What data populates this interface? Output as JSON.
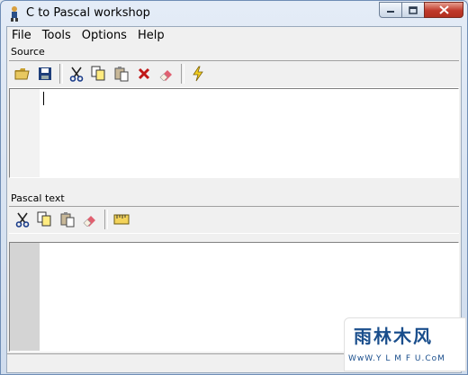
{
  "window": {
    "title": "C to Pascal workshop",
    "icon": "app-icon",
    "controls": [
      "minimize-icon",
      "maximize-icon",
      "close-icon"
    ]
  },
  "menubar": {
    "items": [
      {
        "label": "File"
      },
      {
        "label": "Tools"
      },
      {
        "label": "Options"
      },
      {
        "label": "Help"
      }
    ]
  },
  "source": {
    "label": "Source",
    "toolbar": [
      "open-folder-icon",
      "save-icon",
      "cut-icon",
      "copy-icon",
      "paste-icon",
      "delete-icon",
      "eraser-icon",
      "convert-lightning-icon"
    ],
    "editor_text": ""
  },
  "pascal": {
    "label": "Pascal text",
    "toolbar": [
      "cut-icon",
      "copy-icon",
      "paste-icon",
      "eraser-icon",
      "ruler-icon"
    ],
    "editor_text": ""
  },
  "watermark": {
    "text": "雨林木风",
    "url": "WwW.Y L M F U.CoM"
  },
  "colors": {
    "accent_close": "#c0392b",
    "titlebar": "#dce6f2",
    "gutter": "#d4d4d4"
  }
}
